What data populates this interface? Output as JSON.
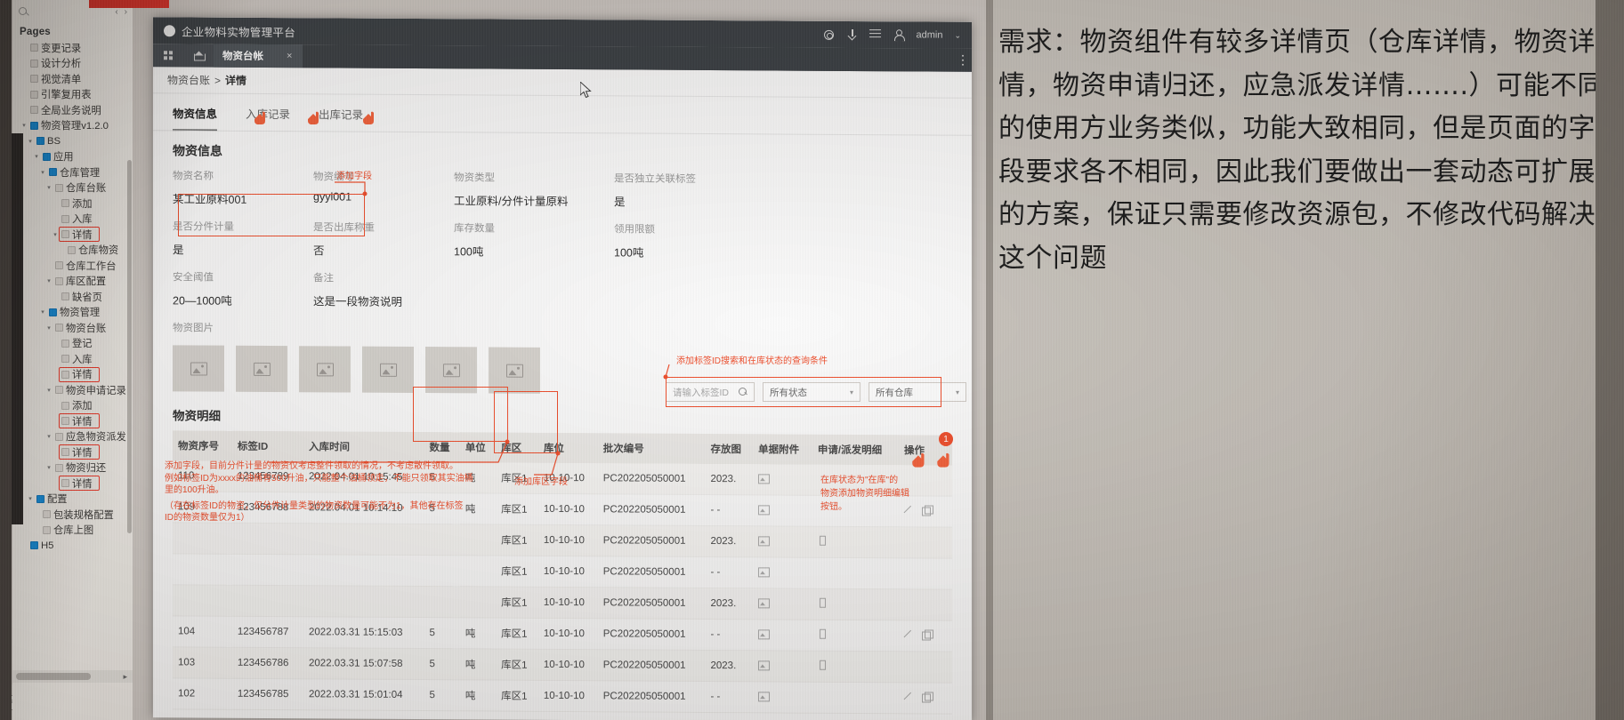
{
  "sidebar": {
    "section_title": "Pages",
    "search_placeholder": "",
    "items": [
      {
        "label": "变更记录",
        "depth": 1,
        "type": "page",
        "highlight": false
      },
      {
        "label": "设计分析",
        "depth": 1,
        "type": "page",
        "highlight": false
      },
      {
        "label": "视觉清单",
        "depth": 1,
        "type": "page",
        "highlight": false
      },
      {
        "label": "引擎复用表",
        "depth": 1,
        "type": "page",
        "highlight": false
      },
      {
        "label": "全局业务说明",
        "depth": 1,
        "type": "page",
        "highlight": false
      },
      {
        "label": "物资管理v1.2.0",
        "depth": 1,
        "type": "folder",
        "caret": true,
        "highlight": false
      },
      {
        "label": "BS",
        "depth": 2,
        "type": "folder",
        "caret": true,
        "highlight": false
      },
      {
        "label": "应用",
        "depth": 3,
        "type": "folder",
        "caret": true,
        "highlight": false
      },
      {
        "label": "仓库管理",
        "depth": 4,
        "type": "folder",
        "caret": true,
        "highlight": false
      },
      {
        "label": "仓库台账",
        "depth": 5,
        "type": "page",
        "caret": true,
        "highlight": false
      },
      {
        "label": "添加",
        "depth": 6,
        "type": "page",
        "highlight": false
      },
      {
        "label": "入库",
        "depth": 6,
        "type": "page",
        "highlight": false
      },
      {
        "label": "详情",
        "depth": 6,
        "type": "page",
        "caret": true,
        "highlight": true
      },
      {
        "label": "仓库物资",
        "depth": 7,
        "type": "page",
        "highlight": false
      },
      {
        "label": "仓库工作台",
        "depth": 5,
        "type": "page",
        "highlight": false
      },
      {
        "label": "库区配置",
        "depth": 5,
        "type": "page",
        "caret": true,
        "highlight": false
      },
      {
        "label": "缺省页",
        "depth": 6,
        "type": "page",
        "highlight": false
      },
      {
        "label": "物资管理",
        "depth": 4,
        "type": "folder",
        "caret": true,
        "highlight": false
      },
      {
        "label": "物资台账",
        "depth": 5,
        "type": "page",
        "caret": true,
        "highlight": false
      },
      {
        "label": "登记",
        "depth": 6,
        "type": "page",
        "highlight": false
      },
      {
        "label": "入库",
        "depth": 6,
        "type": "page",
        "highlight": false
      },
      {
        "label": "详情",
        "depth": 6,
        "type": "page",
        "highlight": true
      },
      {
        "label": "物资申请记录",
        "depth": 5,
        "type": "page",
        "caret": true,
        "highlight": false
      },
      {
        "label": "添加",
        "depth": 6,
        "type": "page",
        "highlight": false
      },
      {
        "label": "详情",
        "depth": 6,
        "type": "page",
        "highlight": true
      },
      {
        "label": "应急物资派发",
        "depth": 5,
        "type": "page",
        "caret": true,
        "highlight": false
      },
      {
        "label": "详情",
        "depth": 6,
        "type": "page",
        "highlight": true
      },
      {
        "label": "物资归还",
        "depth": 5,
        "type": "page",
        "caret": true,
        "highlight": false
      },
      {
        "label": "详情",
        "depth": 6,
        "type": "page",
        "highlight": true
      },
      {
        "label": "配置",
        "depth": 2,
        "type": "folder",
        "caret": true,
        "highlight": false
      },
      {
        "label": "包装规格配置",
        "depth": 3,
        "type": "page",
        "highlight": false
      },
      {
        "label": "仓库上图",
        "depth": 3,
        "type": "page",
        "highlight": false
      },
      {
        "label": "H5",
        "depth": 1,
        "type": "folder",
        "highlight": false
      }
    ]
  },
  "app": {
    "title": "企业物料实物管理平台",
    "user": "admin",
    "header_icons": [
      "gear-icon",
      "download-icon",
      "menu-icon",
      "user-icon",
      "chevron-down-icon"
    ],
    "tab": {
      "label": "物资台帐",
      "close": "×"
    },
    "breadcrumb": {
      "parent": "物资台账",
      "sep": ">",
      "current": "详情"
    },
    "page_tabs": [
      {
        "label": "物资信息",
        "selected": true
      },
      {
        "label": "入库记录",
        "selected": false
      },
      {
        "label": "出库记录",
        "selected": false
      }
    ],
    "section_info_title": "物资信息",
    "fields": [
      {
        "label": "物资名称",
        "value": "某工业原料001"
      },
      {
        "label": "物资编号",
        "value": "gyyl001"
      },
      {
        "label": "物资类型",
        "value": "工业原料/分件计量原料"
      },
      {
        "label": "是否独立关联标签",
        "value": "是"
      },
      {
        "label": "是否分件计量",
        "value": "是"
      },
      {
        "label": "是否出库称重",
        "value": "否"
      },
      {
        "label": "库存数量",
        "value": "100吨"
      },
      {
        "label": "领用限额",
        "value": "100吨"
      },
      {
        "label": "安全阈值",
        "value": "20—1000吨"
      },
      {
        "label": "备注",
        "value": "这是一段物资说明"
      }
    ],
    "images_label": "物资图片",
    "image_count": 6,
    "detail_title": "物资明细",
    "filters": {
      "tag_placeholder": "请输入标签ID",
      "status": "所有状态",
      "warehouse": "所有仓库"
    },
    "table": {
      "columns": [
        "物资序号",
        "标签ID",
        "入库时间",
        "数量",
        "单位",
        "库区",
        "库位",
        "批次编号",
        "存放图",
        "单据附件",
        "申请/派发明细",
        "操作"
      ],
      "rows": [
        {
          "no": "110",
          "tag": "123456789",
          "time": "2022.04.01  10:15:45",
          "qty": "5",
          "unit": "吨",
          "zone": "库区1",
          "loc": "10-10-10",
          "batch": "PC202205050001",
          "store": "2023.",
          "doc": "image-icon",
          "apply": "",
          "op": ""
        },
        {
          "no": "109",
          "tag": "123456788",
          "time": "2022.04.01  10:14:10",
          "qty": "5",
          "unit": "吨",
          "zone": "库区1",
          "loc": "10-10-10",
          "batch": "PC202205050001",
          "store": "- -",
          "doc": "image-icon",
          "apply": "",
          "op": "edit-copy"
        },
        {
          "no": "",
          "tag": "",
          "time": "",
          "qty": "",
          "unit": "",
          "zone": "库区1",
          "loc": "10-10-10",
          "batch": "PC202205050001",
          "store": "2023.",
          "doc": "image-icon",
          "apply": "file-icon",
          "op": ""
        },
        {
          "no": "",
          "tag": "",
          "time": "",
          "qty": "",
          "unit": "",
          "zone": "库区1",
          "loc": "10-10-10",
          "batch": "PC202205050001",
          "store": "- -",
          "doc": "image-icon",
          "apply": "",
          "op": ""
        },
        {
          "no": "",
          "tag": "",
          "time": "",
          "qty": "",
          "unit": "",
          "zone": "库区1",
          "loc": "10-10-10",
          "batch": "PC202205050001",
          "store": "2023.",
          "doc": "image-icon",
          "apply": "file-icon",
          "op": ""
        },
        {
          "no": "104",
          "tag": "123456787",
          "time": "2022.03.31  15:15:03",
          "qty": "5",
          "unit": "吨",
          "zone": "库区1",
          "loc": "10-10-10",
          "batch": "PC202205050001",
          "store": "- -",
          "doc": "image-icon",
          "apply": "file-icon",
          "op": "edit-copy"
        },
        {
          "no": "103",
          "tag": "123456786",
          "time": "2022.03.31  15:07:58",
          "qty": "5",
          "unit": "吨",
          "zone": "库区1",
          "loc": "10-10-10",
          "batch": "PC202205050001",
          "store": "2023.",
          "doc": "image-icon",
          "apply": "file-icon",
          "op": ""
        },
        {
          "no": "102",
          "tag": "123456785",
          "time": "2022.03.31  15:01:04",
          "qty": "5",
          "unit": "吨",
          "zone": "库区1",
          "loc": "10-10-10",
          "batch": "PC202205050001",
          "store": "- -",
          "doc": "image-icon",
          "apply": "",
          "op": "edit-copy"
        }
      ]
    }
  },
  "annotations": {
    "add_field": "添加字段",
    "search_note": "添加标签ID搜索和在库状态的查询条件",
    "qty_note_1": "添加字段，目前分件计量的物资仅考虑整件领取的情况，不考虑散件领取。",
    "qty_note_2": "例如标签ID为xxxx的油桶有500升油，只能整个油桶领走，不能只领取其实油桶",
    "qty_note_3": "里的100升油。",
    "qty_note_4": "（存在标签ID的物资，仅分件计量类型的物资数量可能不为1，其他存在标签",
    "qty_note_5": "ID的物资数量仅为1）",
    "zone_note": "添加库区字段",
    "status_note_1": "在库状态为\"在库\"的",
    "status_note_2": "物资添加物资明细编辑",
    "status_note_3": "按钮。",
    "badge": "1"
  },
  "requirement": {
    "text": "需求：物资组件有较多详情页（仓库详情，物资详情，物资申请归还，应急派发详情…….）可能不同的使用方业务类似，功能大致相同，但是页面的字段要求各不相同，因此我们要做出一套动态可扩展的方案，保证只需要修改资源包，不修改代码解决这个问题"
  },
  "colors": {
    "accent_red": "#f0502e",
    "header_dark": "#3d4145",
    "tree_blue": "#178cd8",
    "highlight_red": "#ee3a2b"
  }
}
